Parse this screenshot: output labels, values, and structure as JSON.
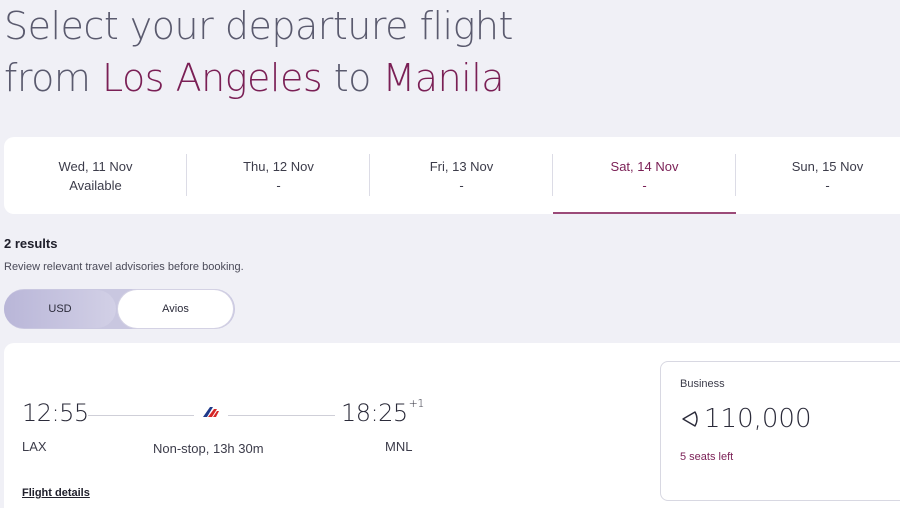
{
  "heading": {
    "line1": "Select your departure flight",
    "from_word": "from",
    "origin": "Los Angeles",
    "to_word": "to",
    "destination": "Manila"
  },
  "dates": [
    {
      "label": "Wed, 11 Nov",
      "status": "Available",
      "selected": false
    },
    {
      "label": "Thu, 12 Nov",
      "status": "-",
      "selected": false
    },
    {
      "label": "Fri, 13 Nov",
      "status": "-",
      "selected": false
    },
    {
      "label": "Sat, 14 Nov",
      "status": "-",
      "selected": true
    },
    {
      "label": "Sun, 15 Nov",
      "status": "-",
      "selected": false
    }
  ],
  "results": {
    "count": "2 results",
    "advisory": "Review relevant travel advisories before booking."
  },
  "currency_toggle": {
    "options": [
      "USD",
      "Avios"
    ],
    "selected": "USD"
  },
  "flight": {
    "departure_time": "12:55",
    "arrival_time": "18:25",
    "arrival_day_offset": "+1",
    "origin_code": "LAX",
    "destination_code": "MNL",
    "duration": "Non-stop, 13h 30m",
    "details_link": "Flight details",
    "airline_logo": "philippine-airlines-logo-icon",
    "fare": {
      "cabin": "Business",
      "currency_icon": "avios-icon",
      "price": "110,000",
      "seats": "5 seats left"
    }
  },
  "colors": {
    "accent": "#7a1f55",
    "background": "#f0f0f6",
    "toggle_selected": "#c9c7e0"
  }
}
